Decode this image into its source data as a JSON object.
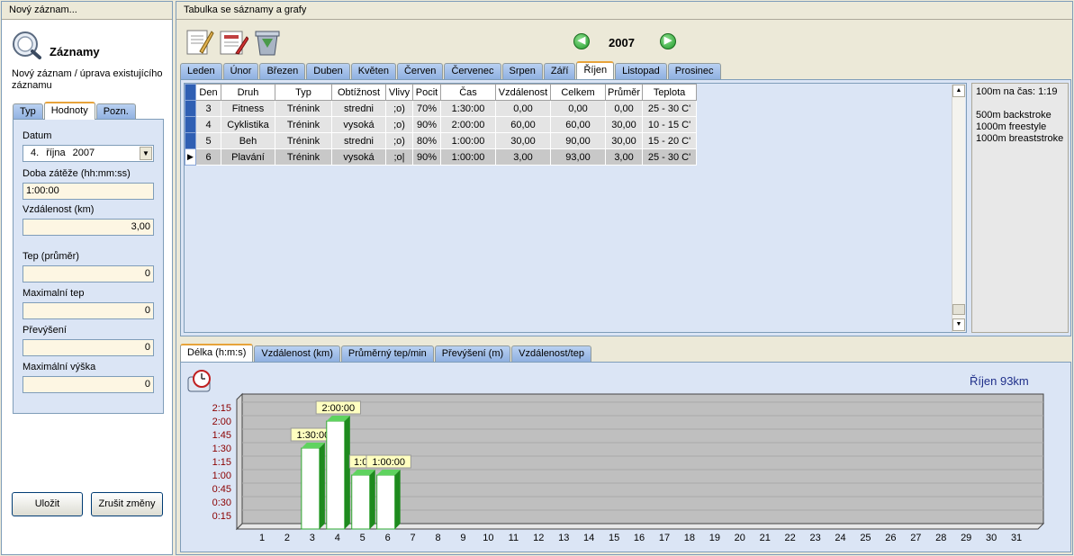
{
  "left_panel": {
    "title": "Nový záznam...",
    "app_name": "Záznamy",
    "description": "Nový záznam / úprava existujícího záznamu",
    "tabs": [
      "Typ",
      "Hodnoty",
      "Pozn."
    ],
    "fields": {
      "datum_label": "Datum",
      "datum_day": "4.",
      "datum_month": "října",
      "datum_year": "2007",
      "doba_label": "Doba zátěže (hh:mm:ss)",
      "doba_value": "1:00:00",
      "vzdalenost_label": "Vzdálenost (km)",
      "vzdalenost_value": "3,00",
      "tep_label": "Tep (průměr)",
      "tep_value": "0",
      "maxtep_label": "Maximalní tep",
      "maxtep_value": "0",
      "prevyseni_label": "Převýšení",
      "prevyseni_value": "0",
      "maxvyska_label": "Maximální výška",
      "maxvyska_value": "0"
    },
    "save_label": "Uložit",
    "cancel_label": "Zrušit změny"
  },
  "right_panel": {
    "title": "Tabulka se sáznamy a grafy",
    "year": "2007",
    "month_tabs": [
      "Leden",
      "Únor",
      "Březen",
      "Duben",
      "Květen",
      "Červen",
      "Červenec",
      "Srpen",
      "Září",
      "Říjen",
      "Listopad",
      "Prosinec"
    ],
    "active_month_index": 9,
    "table": {
      "columns": [
        "Den",
        "Druh",
        "Typ",
        "Obtížnost",
        "Vlivy",
        "Pocit",
        "Čas",
        "Vzdálenost",
        "Celkem",
        "Průměr",
        "Teplota"
      ],
      "rows": [
        [
          "3",
          "Fitness",
          "Trénink",
          "stredni",
          ";o)",
          "70%",
          "1:30:00",
          "0,00",
          "0,00",
          "0,00",
          "25 - 30 C'"
        ],
        [
          "4",
          "Cyklistika",
          "Trénink",
          "vysoká",
          ";o)",
          "90%",
          "2:00:00",
          "60,00",
          "60,00",
          "30,00",
          "10 - 15 C'"
        ],
        [
          "5",
          "Beh",
          "Trénink",
          "stredni",
          ";o)",
          "80%",
          "1:00:00",
          "30,00",
          "90,00",
          "30,00",
          "15 - 20 C'"
        ],
        [
          "6",
          "Plavání",
          "Trénink",
          "vysoká",
          ";o|",
          "90%",
          "1:00:00",
          "3,00",
          "93,00",
          "3,00",
          "25 - 30 C'"
        ]
      ],
      "selected_row": 3
    },
    "notes": {
      "line1": "100m na čas: 1:19",
      "line2": "500m backstroke",
      "line3": "1000m freestyle",
      "line4": "1000m breaststroke"
    },
    "chart_tabs": [
      "Délka (h:m:s)",
      "Vzdálenost (km)",
      "Průměrný tep/min",
      "Převýšení (m)",
      "Vzdálenost/tep"
    ],
    "active_chart_tab": 0,
    "chart_title": "Říjen 93km"
  },
  "chart_data": {
    "type": "bar",
    "title": "Říjen 93km",
    "categories": [
      "1",
      "2",
      "3",
      "4",
      "5",
      "6",
      "7",
      "8",
      "9",
      "10",
      "11",
      "12",
      "13",
      "14",
      "15",
      "16",
      "17",
      "18",
      "19",
      "20",
      "21",
      "22",
      "23",
      "24",
      "25",
      "26",
      "27",
      "28",
      "29",
      "30",
      "31"
    ],
    "values_minutes": [
      0,
      0,
      90,
      120,
      60,
      60,
      0,
      0,
      0,
      0,
      0,
      0,
      0,
      0,
      0,
      0,
      0,
      0,
      0,
      0,
      0,
      0,
      0,
      0,
      0,
      0,
      0,
      0,
      0,
      0,
      0
    ],
    "data_labels": {
      "3": "1:30:00",
      "4": "2:00:00",
      "5": "1:00",
      "6": "1:00:00"
    },
    "yticks": [
      "0:15",
      "0:30",
      "0:45",
      "1:00",
      "1:15",
      "1:30",
      "1:45",
      "2:00",
      "2:15"
    ],
    "ylim_minutes": [
      0,
      150
    ],
    "grid": true,
    "colors": {
      "bar": "#2eab2e",
      "bar_face": "#ffffff",
      "plot_bg": "#bfbfbf",
      "tick": "#8b0000",
      "label_bg": "#ffffc0"
    }
  }
}
